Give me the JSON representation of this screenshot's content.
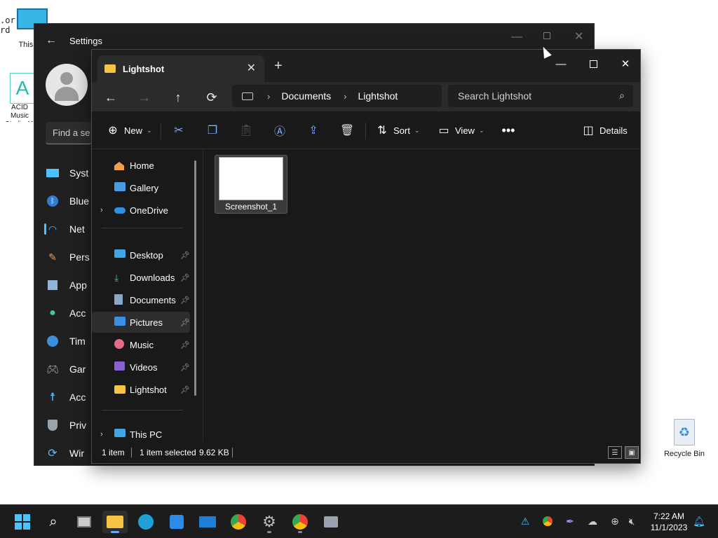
{
  "desktop": {
    "icons": [
      {
        "label": "This PC"
      },
      {
        "label": "ACID Music Studio 11"
      },
      {
        "label": "Recycle Bin"
      }
    ],
    "fragment_left_top": ".or\nrd"
  },
  "settings": {
    "title": "Settings",
    "search_placeholder": "Find a se",
    "nav": [
      {
        "label": "Syst",
        "icon": "monitor-icon"
      },
      {
        "label": "Blue",
        "icon": "bluetooth-icon"
      },
      {
        "label": "Net",
        "icon": "wifi-icon"
      },
      {
        "label": "Pers",
        "icon": "brush-icon"
      },
      {
        "label": "App",
        "icon": "apps-icon"
      },
      {
        "label": "Acc",
        "icon": "person-icon"
      },
      {
        "label": "Tim",
        "icon": "globe-clock-icon"
      },
      {
        "label": "Gar",
        "icon": "gamepad-icon"
      },
      {
        "label": "Acc",
        "icon": "accessibility-icon"
      },
      {
        "label": "Priv",
        "icon": "shield-icon"
      },
      {
        "label": "Wir",
        "icon": "update-icon"
      }
    ]
  },
  "explorer": {
    "tab_title": "Lightshot",
    "breadcrumbs": [
      "Documents",
      "Lightshot"
    ],
    "search_placeholder": "Search Lightshot",
    "toolbar": {
      "new_label": "New",
      "sort_label": "Sort",
      "view_label": "View",
      "details_label": "Details"
    },
    "nav": [
      {
        "label": "Home",
        "icon": "home-icon",
        "pinned": false
      },
      {
        "label": "Gallery",
        "icon": "gallery-icon",
        "pinned": false
      },
      {
        "label": "OneDrive",
        "icon": "cloud-icon",
        "pinned": false,
        "expandable": true
      },
      {
        "label": "Desktop",
        "icon": "desktop-icon",
        "pinned": true
      },
      {
        "label": "Downloads",
        "icon": "download-icon",
        "pinned": true
      },
      {
        "label": "Documents",
        "icon": "document-icon",
        "pinned": true
      },
      {
        "label": "Pictures",
        "icon": "pictures-icon",
        "pinned": true,
        "selected": true
      },
      {
        "label": "Music",
        "icon": "music-icon",
        "pinned": true
      },
      {
        "label": "Videos",
        "icon": "video-icon",
        "pinned": true
      },
      {
        "label": "Lightshot",
        "icon": "folder-icon",
        "pinned": true
      },
      {
        "label": "This PC",
        "icon": "pc-icon",
        "pinned": false,
        "expandable": true
      }
    ],
    "files": [
      {
        "name": "Screenshot_1"
      }
    ],
    "status": {
      "count": "1 item",
      "selected": "1 item selected",
      "size": "9.62 KB"
    }
  },
  "taskbar": {
    "apps": [
      "start-icon",
      "search-icon",
      "task-view-icon",
      "file-explorer-icon",
      "edge-icon",
      "store-icon",
      "mail-icon",
      "chrome-icon",
      "settings-icon",
      "chrome-icon",
      "network-app-icon"
    ],
    "clock_time": "7:22 AM",
    "clock_date": "11/1/2023"
  },
  "colors": {
    "accent": "#4cc2ff",
    "folder": "#f6c343",
    "window_bg": "#191919"
  }
}
